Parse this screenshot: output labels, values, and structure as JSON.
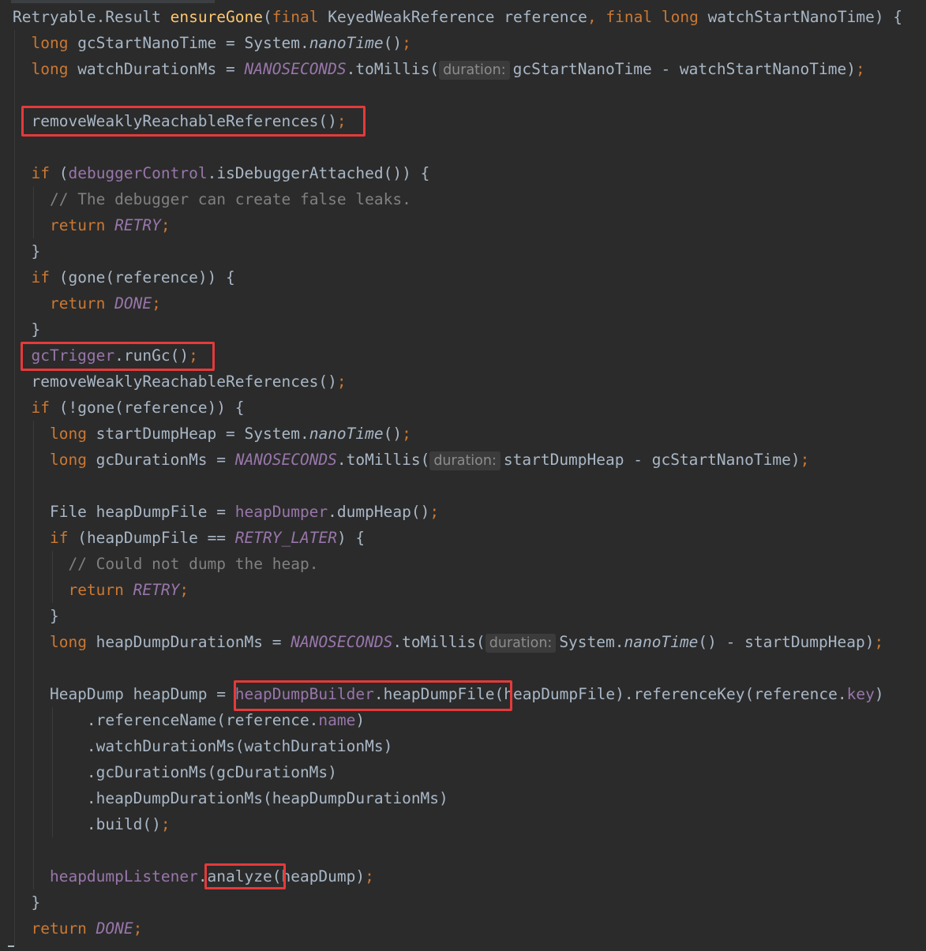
{
  "code": {
    "lines": [
      [
        {
          "t": "Retryable.Result "
        },
        {
          "t": "ensureGone",
          "c": "fn"
        },
        {
          "t": "("
        },
        {
          "t": "final ",
          "c": "kw"
        },
        {
          "t": "KeyedWeakReference reference"
        },
        {
          "t": ", ",
          "c": "kw"
        },
        {
          "t": "final long ",
          "c": "kw"
        },
        {
          "t": "watchStartNanoTime) {"
        }
      ],
      [
        {
          "t": "  "
        },
        {
          "t": "long ",
          "c": "kw"
        },
        {
          "t": "gcStartNanoTime = System."
        },
        {
          "t": "nanoTime",
          "c": "it"
        },
        {
          "t": "()"
        },
        {
          "t": ";",
          "c": "kw"
        }
      ],
      [
        {
          "t": "  "
        },
        {
          "t": "long ",
          "c": "kw"
        },
        {
          "t": "watchDurationMs = "
        },
        {
          "t": "NANOSECONDS",
          "c": "st"
        },
        {
          "t": ".toMillis("
        },
        {
          "t": "duration:",
          "c": "hint"
        },
        {
          "t": "gcStartNanoTime - watchStartNanoTime)"
        },
        {
          "t": ";",
          "c": "kw"
        }
      ],
      [],
      [
        {
          "t": "  removeWeaklyReachableReferences()"
        },
        {
          "t": ";",
          "c": "kw"
        }
      ],
      [],
      [
        {
          "t": "  "
        },
        {
          "t": "if ",
          "c": "kw"
        },
        {
          "t": "("
        },
        {
          "t": "debuggerControl",
          "c": "fld"
        },
        {
          "t": ".isDebuggerAttached()) {"
        }
      ],
      [
        {
          "t": "    "
        },
        {
          "t": "// The debugger can create false leaks.",
          "c": "cm"
        }
      ],
      [
        {
          "t": "    "
        },
        {
          "t": "return ",
          "c": "kw"
        },
        {
          "t": "RETRY",
          "c": "st"
        },
        {
          "t": ";",
          "c": "kw"
        }
      ],
      [
        {
          "t": "  }"
        }
      ],
      [
        {
          "t": "  "
        },
        {
          "t": "if ",
          "c": "kw"
        },
        {
          "t": "(gone(reference)) {"
        }
      ],
      [
        {
          "t": "    "
        },
        {
          "t": "return ",
          "c": "kw"
        },
        {
          "t": "DONE",
          "c": "st"
        },
        {
          "t": ";",
          "c": "kw"
        }
      ],
      [
        {
          "t": "  }"
        }
      ],
      [
        {
          "t": "  "
        },
        {
          "t": "gcTrigger",
          "c": "fld"
        },
        {
          "t": ".runGc()"
        },
        {
          "t": ";",
          "c": "kw"
        }
      ],
      [
        {
          "t": "  removeWeaklyReachableReferences()"
        },
        {
          "t": ";",
          "c": "kw"
        }
      ],
      [
        {
          "t": "  "
        },
        {
          "t": "if ",
          "c": "kw"
        },
        {
          "t": "(!gone(reference)) {"
        }
      ],
      [
        {
          "t": "    "
        },
        {
          "t": "long ",
          "c": "kw"
        },
        {
          "t": "startDumpHeap = System."
        },
        {
          "t": "nanoTime",
          "c": "it"
        },
        {
          "t": "()"
        },
        {
          "t": ";",
          "c": "kw"
        }
      ],
      [
        {
          "t": "    "
        },
        {
          "t": "long ",
          "c": "kw"
        },
        {
          "t": "gcDurationMs = "
        },
        {
          "t": "NANOSECONDS",
          "c": "st"
        },
        {
          "t": ".toMillis("
        },
        {
          "t": "duration:",
          "c": "hint"
        },
        {
          "t": "startDumpHeap - gcStartNanoTime)"
        },
        {
          "t": ";",
          "c": "kw"
        }
      ],
      [],
      [
        {
          "t": "    File heapDumpFile = "
        },
        {
          "t": "heapDumper",
          "c": "fld"
        },
        {
          "t": ".dumpHeap()"
        },
        {
          "t": ";",
          "c": "kw"
        }
      ],
      [
        {
          "t": "    "
        },
        {
          "t": "if ",
          "c": "kw"
        },
        {
          "t": "(heapDumpFile == "
        },
        {
          "t": "RETRY_LATER",
          "c": "st"
        },
        {
          "t": ") {"
        }
      ],
      [
        {
          "t": "      "
        },
        {
          "t": "// Could not dump the heap.",
          "c": "cm"
        }
      ],
      [
        {
          "t": "      "
        },
        {
          "t": "return ",
          "c": "kw"
        },
        {
          "t": "RETRY",
          "c": "st"
        },
        {
          "t": ";",
          "c": "kw"
        }
      ],
      [
        {
          "t": "    }"
        }
      ],
      [
        {
          "t": "    "
        },
        {
          "t": "long ",
          "c": "kw"
        },
        {
          "t": "heapDumpDurationMs = "
        },
        {
          "t": "NANOSECONDS",
          "c": "st"
        },
        {
          "t": ".toMillis("
        },
        {
          "t": "duration:",
          "c": "hint"
        },
        {
          "t": "System."
        },
        {
          "t": "nanoTime",
          "c": "it"
        },
        {
          "t": "() - startDumpHeap)"
        },
        {
          "t": ";",
          "c": "kw"
        }
      ],
      [],
      [
        {
          "t": "    HeapDump heapDump = "
        },
        {
          "t": "heapDumpBuilder",
          "c": "fld"
        },
        {
          "t": ".heapDumpFile(heapDumpFile).referenceKey(reference."
        },
        {
          "t": "key",
          "c": "fld"
        },
        {
          "t": ")"
        }
      ],
      [
        {
          "t": "        .referenceName(reference."
        },
        {
          "t": "name",
          "c": "fld"
        },
        {
          "t": ")"
        }
      ],
      [
        {
          "t": "        .watchDurationMs(watchDurationMs)"
        }
      ],
      [
        {
          "t": "        .gcDurationMs(gcDurationMs)"
        }
      ],
      [
        {
          "t": "        .heapDumpDurationMs(heapDumpDurationMs)"
        }
      ],
      [
        {
          "t": "        .build()"
        },
        {
          "t": ";",
          "c": "kw"
        }
      ],
      [],
      [
        {
          "t": "    "
        },
        {
          "t": "heapdumpListener",
          "c": "fld"
        },
        {
          "t": ".analyze(heapDump)"
        },
        {
          "t": ";",
          "c": "kw"
        }
      ],
      [
        {
          "t": "  }"
        }
      ],
      [
        {
          "t": "  "
        },
        {
          "t": "return ",
          "c": "kw"
        },
        {
          "t": "DONE",
          "c": "st"
        },
        {
          "t": ";",
          "c": "kw"
        }
      ]
    ]
  },
  "colors": {
    "background": "#2b2b2b",
    "text": "#a9b7c6",
    "keyword": "#cc7832",
    "method_declaration": "#ffc66d",
    "field": "#9876aa",
    "comment": "#808080",
    "highlight_box": "#e53a3a"
  }
}
